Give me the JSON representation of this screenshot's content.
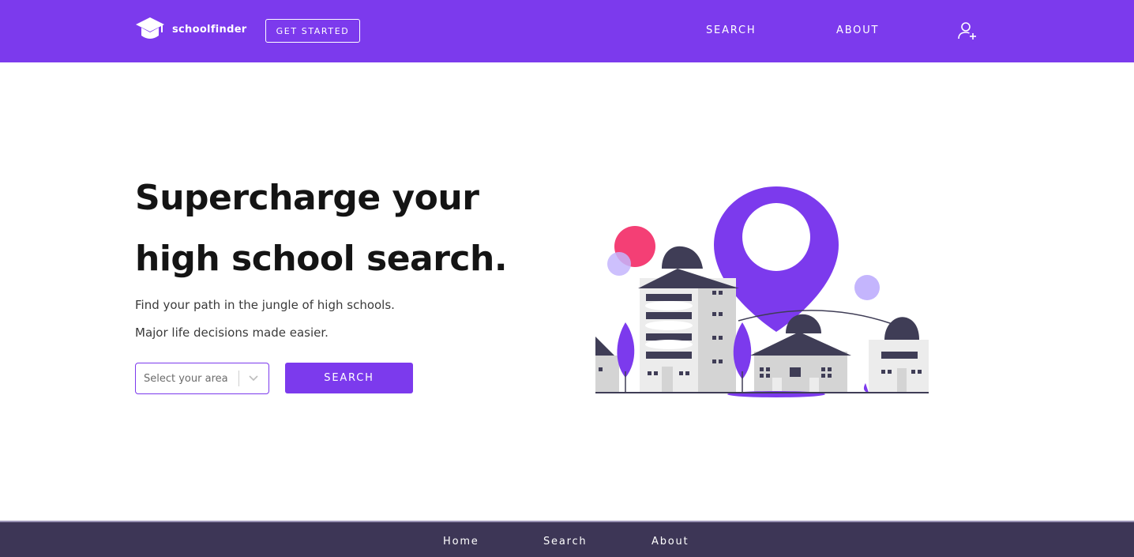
{
  "header": {
    "brand": "schoolfinder",
    "get_started_label": "GET STARTED",
    "nav": {
      "search": "SEARCH",
      "about": "ABOUT"
    },
    "icons": {
      "logo": "graduation-cap-icon",
      "account": "user-plus-icon"
    }
  },
  "hero": {
    "title": "Supercharge your high school search.",
    "subtitle_1": "Find your path in the jungle of high schools.",
    "subtitle_2": "Major life decisions made easier.",
    "area_select": {
      "placeholder": "Select your area"
    },
    "search_button_label": "SEARCH",
    "illustration": "city-school-location-illustration"
  },
  "footer": {
    "home": "Home",
    "search": "Search",
    "about": "About"
  },
  "colors": {
    "brand": "#7c3aed",
    "footer_bg": "#3d3656",
    "building_dark": "#3f3d56",
    "accent_pink": "#f43f75",
    "accent_lilac": "#c4b5fd"
  }
}
